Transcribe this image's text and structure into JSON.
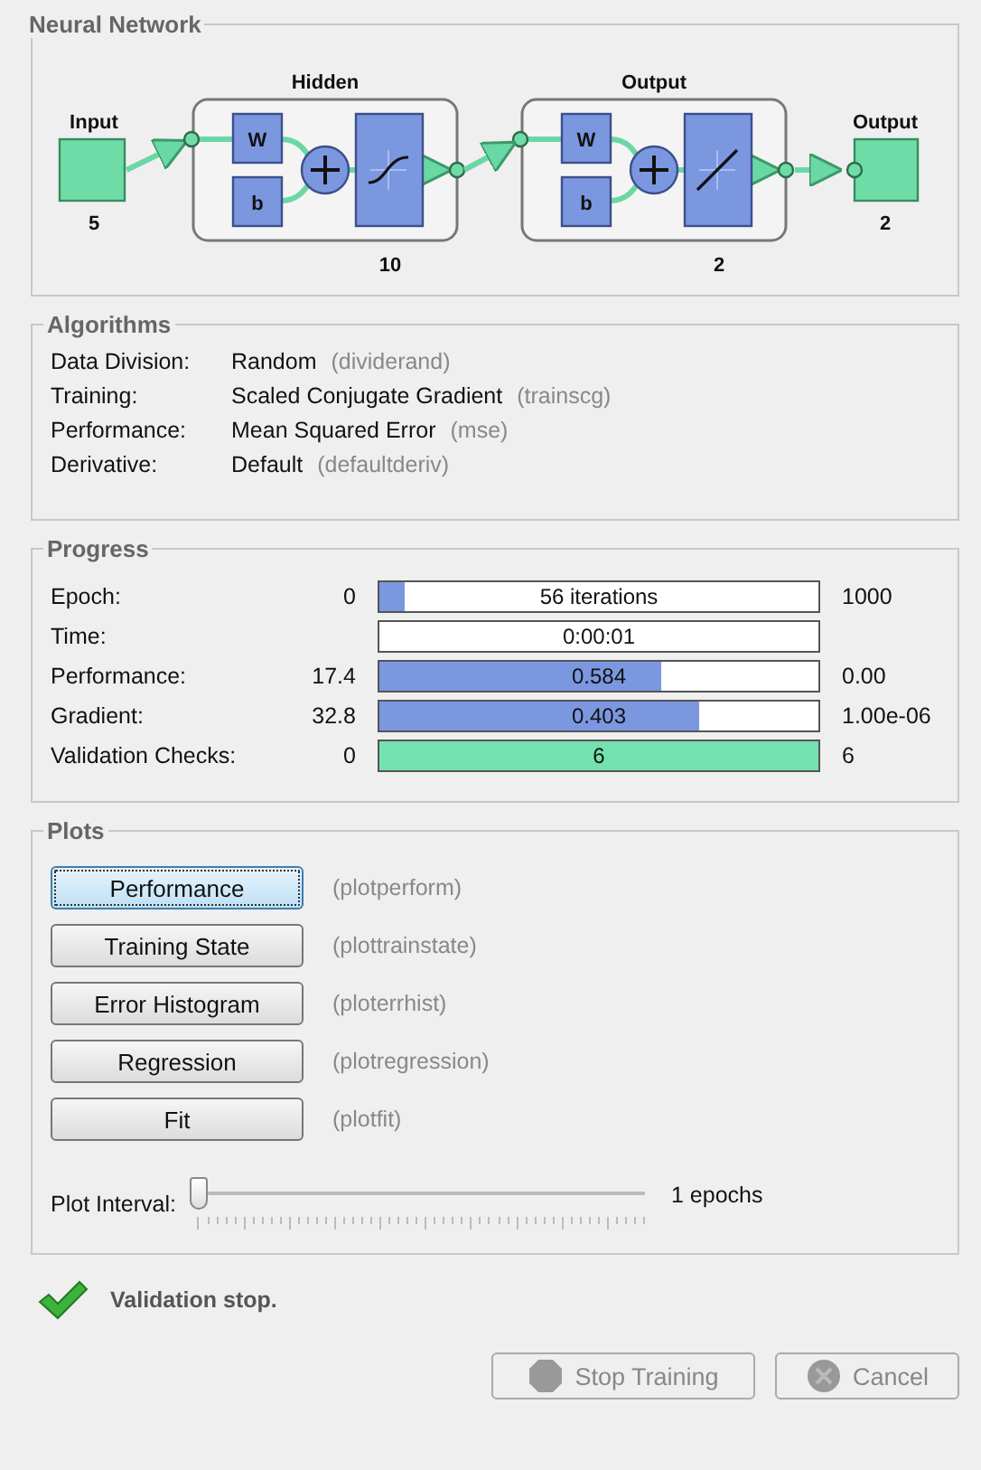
{
  "network": {
    "title": "Neural Network",
    "input": {
      "label": "Input",
      "size": "5"
    },
    "layers": [
      {
        "title": "Hidden",
        "size": "10",
        "weight_label": "W",
        "bias_label": "b",
        "kind": "sigmoid"
      },
      {
        "title": "Output",
        "size": "2",
        "weight_label": "W",
        "bias_label": "b",
        "kind": "linear"
      }
    ],
    "output": {
      "label": "Output",
      "size": "2"
    }
  },
  "algorithms": {
    "title": "Algorithms",
    "rows": [
      {
        "label": "Data Division:",
        "value": "Random",
        "function": "(dividerand)"
      },
      {
        "label": "Training:",
        "value": "Scaled Conjugate Gradient",
        "function": "(trainscg)"
      },
      {
        "label": "Performance:",
        "value": "Mean Squared Error",
        "function": "(mse)"
      },
      {
        "label": "Derivative:",
        "value": "Default",
        "function": "(defaultderiv)"
      }
    ]
  },
  "progress": {
    "title": "Progress",
    "rows": [
      {
        "label": "Epoch:",
        "start": "0",
        "reading": "56 iterations",
        "end": "1000",
        "level": 0.056,
        "kind": "count"
      },
      {
        "label": "Time:",
        "reading": "0:00:01",
        "kind": "time"
      },
      {
        "label": "Performance:",
        "start": "17.4",
        "reading": "0.584",
        "end": "0.00",
        "level": 0.64,
        "kind": "count"
      },
      {
        "label": "Gradient:",
        "start": "32.8",
        "reading": "0.403",
        "end": "1.00e-06",
        "level": 0.73,
        "kind": "count"
      },
      {
        "label": "Validation Checks:",
        "start": "0",
        "reading": "6",
        "end": "6",
        "level": 1,
        "kind": "checks"
      }
    ]
  },
  "plots": {
    "title": "Plots",
    "buttons": [
      {
        "label": "Performance",
        "function": "(plotperform)",
        "focused": true
      },
      {
        "label": "Training State",
        "function": "(plottrainstate)",
        "focused": false
      },
      {
        "label": "Error Histogram",
        "function": "(ploterrhist)",
        "focused": false
      },
      {
        "label": "Regression",
        "function": "(plotregression)",
        "focused": false
      },
      {
        "label": "Fit",
        "function": "(plotfit)",
        "focused": false
      }
    ],
    "interval": {
      "label": "Plot Interval:",
      "level": 0,
      "reading": "1 epochs"
    }
  },
  "status": {
    "message": "Validation stop."
  },
  "actions": [
    {
      "label": "Stop Training",
      "kind": "stop",
      "disabled": true
    },
    {
      "label": "Cancel",
      "kind": "cancel",
      "disabled": true
    }
  ]
}
